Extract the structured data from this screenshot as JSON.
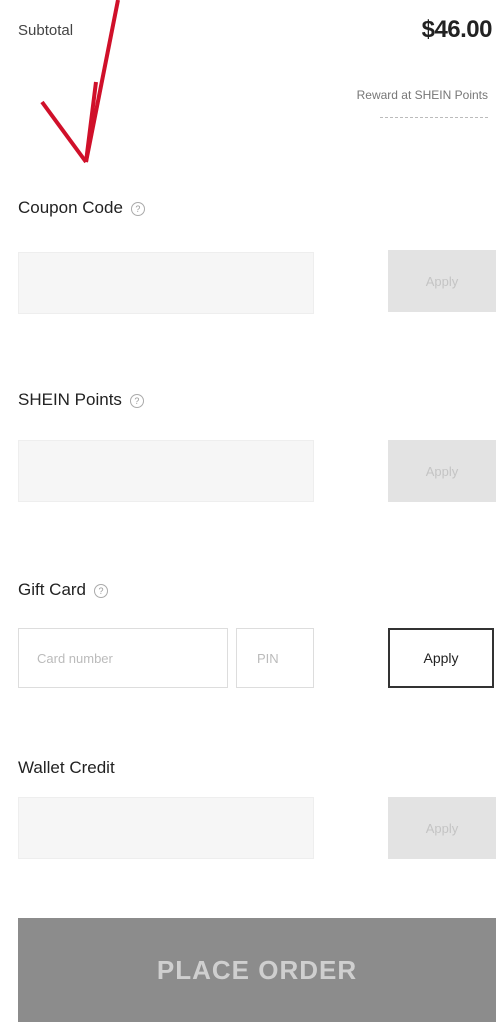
{
  "summary": {
    "subtotal_label": "Subtotal",
    "subtotal_value": "$46.00",
    "points_note": "Reward at SHEIN Points"
  },
  "coupon": {
    "label": "Coupon Code",
    "apply_label": "Apply"
  },
  "points": {
    "label": "SHEIN Points",
    "apply_label": "Apply"
  },
  "gift_card": {
    "label": "Gift Card",
    "number_placeholder": "Card number",
    "pin_placeholder": "PIN",
    "apply_label": "Apply"
  },
  "wallet": {
    "label": "Wallet Credit",
    "apply_label": "Apply"
  },
  "place_order": {
    "label": "PLACE ORDER"
  },
  "colors": {
    "annotation_arrow": "#d0102a",
    "place_order_bg": "#8c8c8c"
  }
}
